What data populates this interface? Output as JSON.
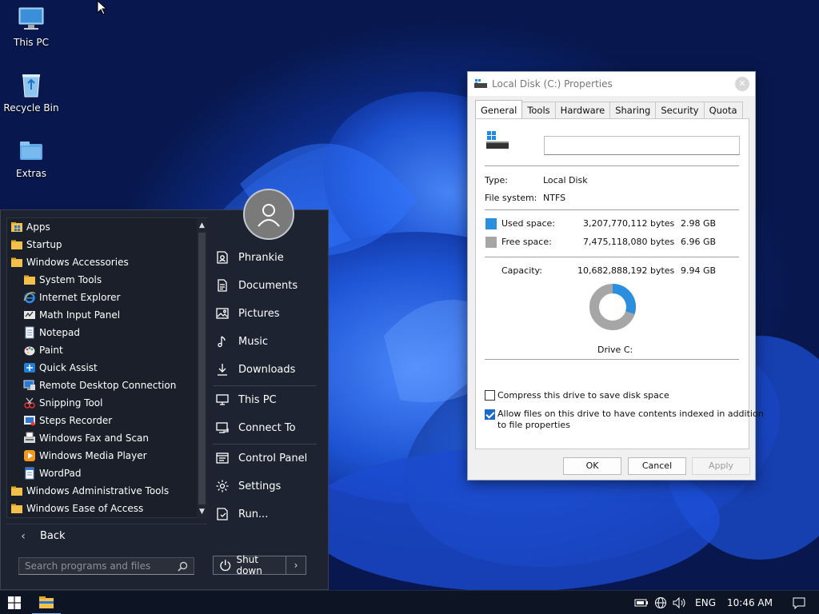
{
  "desktop": {
    "icons": [
      {
        "label": "This PC"
      },
      {
        "label": "Recycle Bin"
      },
      {
        "label": "Extras"
      }
    ]
  },
  "start_menu": {
    "programs": [
      {
        "label": "Apps",
        "level": 0,
        "icon": "apps-folder-icon"
      },
      {
        "label": "Startup",
        "level": 0,
        "icon": "folder-icon"
      },
      {
        "label": "Windows Accessories",
        "level": 0,
        "icon": "folder-icon"
      },
      {
        "label": "System Tools",
        "level": 1,
        "icon": "folder-icon"
      },
      {
        "label": "Internet Explorer",
        "level": 1,
        "icon": "internet-explorer-icon"
      },
      {
        "label": "Math Input Panel",
        "level": 1,
        "icon": "math-input-icon"
      },
      {
        "label": "Notepad",
        "level": 1,
        "icon": "notepad-icon"
      },
      {
        "label": "Paint",
        "level": 1,
        "icon": "paint-icon"
      },
      {
        "label": "Quick Assist",
        "level": 1,
        "icon": "quick-assist-icon"
      },
      {
        "label": "Remote Desktop Connection",
        "level": 1,
        "icon": "remote-desktop-icon"
      },
      {
        "label": "Snipping Tool",
        "level": 1,
        "icon": "snipping-tool-icon"
      },
      {
        "label": "Steps Recorder",
        "level": 1,
        "icon": "steps-recorder-icon"
      },
      {
        "label": "Windows Fax and Scan",
        "level": 1,
        "icon": "fax-scan-icon"
      },
      {
        "label": "Windows Media Player",
        "level": 1,
        "icon": "media-player-icon"
      },
      {
        "label": "WordPad",
        "level": 1,
        "icon": "wordpad-icon"
      },
      {
        "label": "Windows Administrative Tools",
        "level": 0,
        "icon": "folder-icon"
      },
      {
        "label": "Windows Ease of Access",
        "level": 0,
        "icon": "folder-icon"
      }
    ],
    "back_label": "Back",
    "search_placeholder": "Search programs and files",
    "user_items": [
      {
        "label": "Phrankie",
        "icon": "user-folder-icon"
      },
      {
        "label": "Documents",
        "icon": "document-icon"
      },
      {
        "label": "Pictures",
        "icon": "picture-icon"
      },
      {
        "label": "Music",
        "icon": "music-icon"
      },
      {
        "label": "Downloads",
        "icon": "download-icon"
      },
      {
        "label": "This PC",
        "icon": "computer-icon"
      },
      {
        "label": "Connect To",
        "icon": "connect-icon"
      },
      {
        "label": "Control Panel",
        "icon": "control-panel-icon"
      },
      {
        "label": "Settings",
        "icon": "gear-icon"
      },
      {
        "label": "Run...",
        "icon": "run-icon"
      }
    ],
    "shutdown_label": "Shut down"
  },
  "dialog": {
    "title": "Local Disk (C:) Properties",
    "tabs": [
      "General",
      "Tools",
      "Hardware",
      "Sharing",
      "Security",
      "Quota"
    ],
    "active_tab": "General",
    "drive_label_value": "",
    "type_label": "Type:",
    "type_value": "Local Disk",
    "fs_label": "File system:",
    "fs_value": "NTFS",
    "used_label": "Used space:",
    "used_bytes": "3,207,770,112 bytes",
    "used_gb": "2.98 GB",
    "free_label": "Free space:",
    "free_bytes": "7,475,118,080 bytes",
    "free_gb": "6.96 GB",
    "capacity_label": "Capacity:",
    "capacity_bytes": "10,682,888,192 bytes",
    "capacity_gb": "9.94 GB",
    "drive_caption": "Drive C:",
    "compress_label": "Compress this drive to save disk space",
    "compress_checked": false,
    "index_label_line1": "Allow files on this drive to have contents indexed in addition",
    "index_label_line2": "to file properties",
    "index_checked": true,
    "ok_label": "OK",
    "cancel_label": "Cancel",
    "apply_label": "Apply",
    "used_color": "#2b8fe0",
    "free_color": "#a6a6a6",
    "used_fraction": 0.3
  },
  "taskbar": {
    "language": "ENG",
    "time": "10:46 AM"
  }
}
